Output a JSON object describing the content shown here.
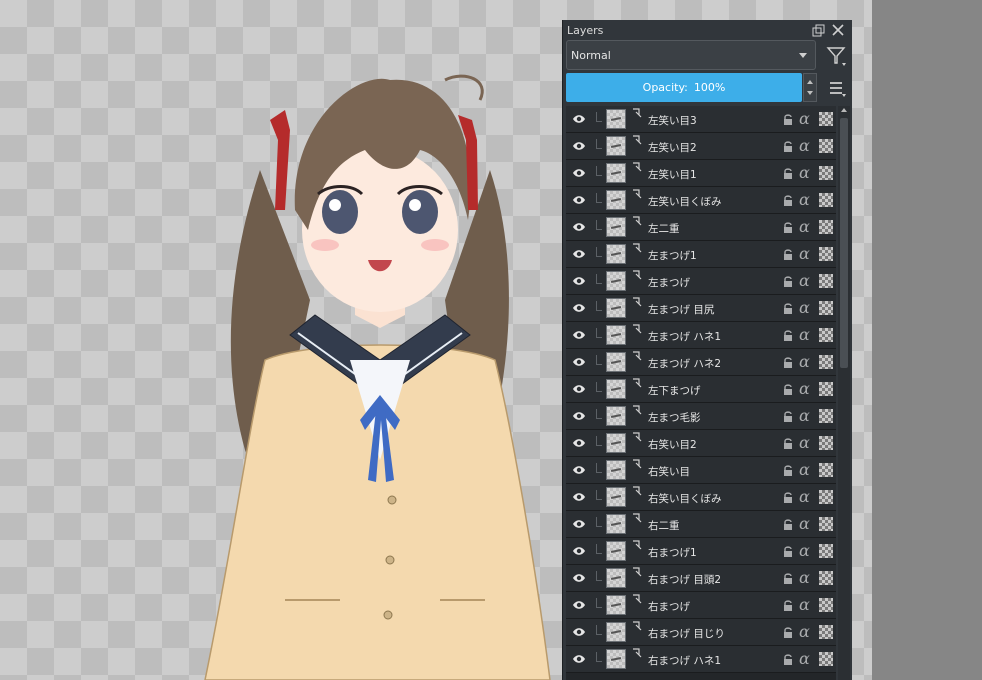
{
  "panel": {
    "title": "Layers",
    "blend_mode": "Normal",
    "opacity_label": "Opacity:",
    "opacity_value": "100%"
  },
  "layers": [
    {
      "name": "左笑い目3"
    },
    {
      "name": "左笑い目2"
    },
    {
      "name": "左笑い目1"
    },
    {
      "name": "左笑い目くぼみ"
    },
    {
      "name": "左二重"
    },
    {
      "name": "左まつげ1"
    },
    {
      "name": "左まつげ"
    },
    {
      "name": "左まつげ 目尻"
    },
    {
      "name": "左まつげ ハネ1"
    },
    {
      "name": "左まつげ ハネ2"
    },
    {
      "name": "左下まつげ"
    },
    {
      "name": "左まつ毛影"
    },
    {
      "name": "右笑い目2"
    },
    {
      "name": "右笑い目"
    },
    {
      "name": "右笑い目くぼみ"
    },
    {
      "name": "右二重"
    },
    {
      "name": "右まつげ1"
    },
    {
      "name": "右まつげ 目頭2"
    },
    {
      "name": "右まつげ"
    },
    {
      "name": "右まつげ 目じり"
    },
    {
      "name": "右まつげ ハネ1"
    }
  ],
  "icons": {
    "visibility": "eye-icon",
    "clipping": "clip-icon",
    "lock": "lock-icon",
    "alpha_lock": "alpha-icon",
    "inherit_alpha": "checker-icon"
  },
  "colors": {
    "panel_bg": "#31363b",
    "accent": "#3daee9",
    "row_bg": "#2a2e32"
  }
}
